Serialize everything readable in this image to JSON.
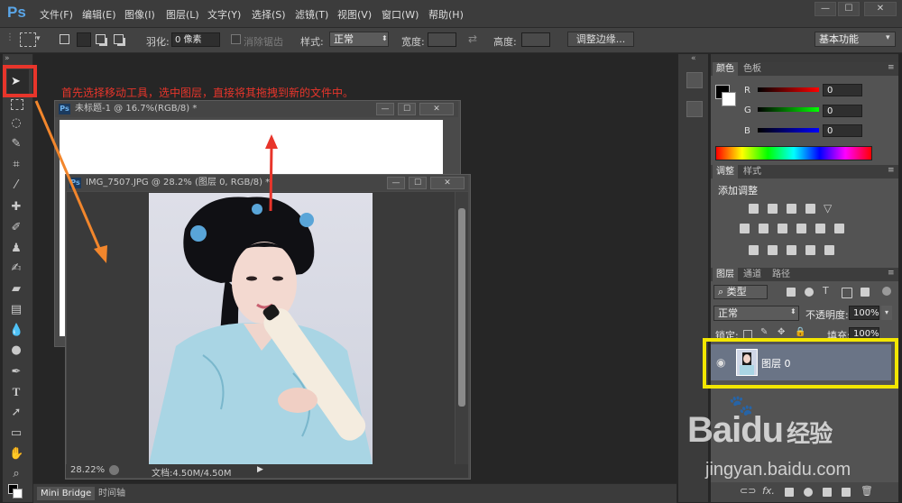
{
  "app": {
    "logo": "Ps"
  },
  "menu": [
    "文件(F)",
    "编辑(E)",
    "图像(I)",
    "图层(L)",
    "文字(Y)",
    "选择(S)",
    "滤镜(T)",
    "视图(V)",
    "窗口(W)",
    "帮助(H)"
  ],
  "window_controls": [
    "—",
    "☐",
    "✕"
  ],
  "options": {
    "feather_label": "羽化:",
    "feather_value": "0 像素",
    "antialias_label": "消除锯齿",
    "style_label": "样式:",
    "style_value": "正常",
    "width_label": "宽度:",
    "height_label": "高度:",
    "refine_button": "调整边缘...",
    "workspace": "基本功能"
  },
  "annotation": {
    "text": "首先选择移动工具，选中图层，直接将其拖拽到新的文件中。",
    "color": "#e8352b"
  },
  "doc1": {
    "title": "未标题-1 @ 16.7%(RGB/8) *"
  },
  "doc2": {
    "title": "IMG_7507.JPG @ 28.2% (图层 0, RGB/8) *",
    "zoom": "28.22%",
    "docinfo": "文档:4.50M/4.50M"
  },
  "color_panel": {
    "tabs": [
      "颜色",
      "色板"
    ],
    "channels": [
      {
        "label": "R",
        "value": "0",
        "color": "#d02020"
      },
      {
        "label": "G",
        "value": "0",
        "color": "#20b020"
      },
      {
        "label": "B",
        "value": "0",
        "color": "#2040d0"
      }
    ]
  },
  "adjust_panel": {
    "tabs": [
      "调整",
      "样式"
    ],
    "title": "添加调整"
  },
  "layers_panel": {
    "tabs": [
      "图层",
      "通道",
      "路径"
    ],
    "filter": "类型",
    "blend": "正常",
    "opacity_label": "不透明度:",
    "opacity": "100%",
    "lock_label": "锁定:",
    "fill_label": "填充:",
    "fill": "100%",
    "layer_name": "图层 0"
  },
  "bottom_tabs": [
    "Mini Bridge",
    "时间轴"
  ],
  "watermark": {
    "brand": "Baidu",
    "site": "jingyan.baidu.com",
    "cn": "经验"
  },
  "highlight_colors": {
    "red": "#e8352b",
    "yellow": "#f2e600",
    "orange": "#f2862c"
  }
}
